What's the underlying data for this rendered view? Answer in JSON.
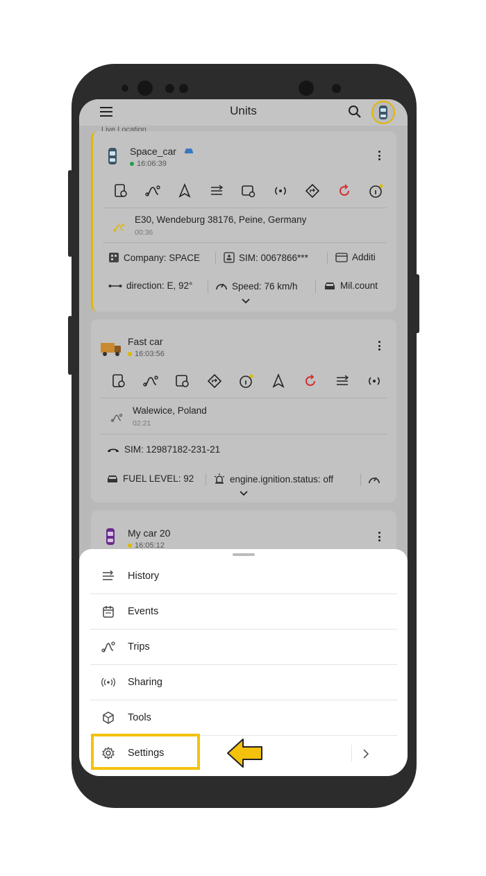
{
  "app_bar": {
    "title": "Units"
  },
  "peek_text": "Live Location",
  "units": [
    {
      "name": "Space_car",
      "time": "16:06:39",
      "status_color": "#1ea046",
      "address": "E30, Wendeburg 38176, Peine, Germany",
      "address_time": "00:36",
      "info_row1": [
        "Company: SPACE",
        "SIM: 0067866***",
        "Additi"
      ],
      "info_row2": [
        "direction: E, 92°",
        "Speed: 76 km/h",
        "Mil.count"
      ]
    },
    {
      "name": "Fast car",
      "time": "16:03:56",
      "status_color": "#e0b700",
      "address": "Walewice, Poland",
      "address_time": "02:21",
      "sim": "SIM: 12987182-231-21",
      "info_row2": [
        "FUEL LEVEL: 92",
        "engine.ignition.status: off"
      ]
    },
    {
      "name": "My car 20",
      "time": "16:05:12",
      "status_color": "#e0b700"
    }
  ],
  "sheet": {
    "items": [
      {
        "label": "History",
        "icon": "history-icon"
      },
      {
        "label": "Events",
        "icon": "events-icon"
      },
      {
        "label": "Trips",
        "icon": "trips-icon"
      },
      {
        "label": "Sharing",
        "icon": "sharing-icon"
      },
      {
        "label": "Tools",
        "icon": "tools-icon"
      },
      {
        "label": "Settings",
        "icon": "gear-icon"
      }
    ]
  },
  "colors": {
    "accent": "#f4c20d",
    "alert": "#d32f2f"
  }
}
